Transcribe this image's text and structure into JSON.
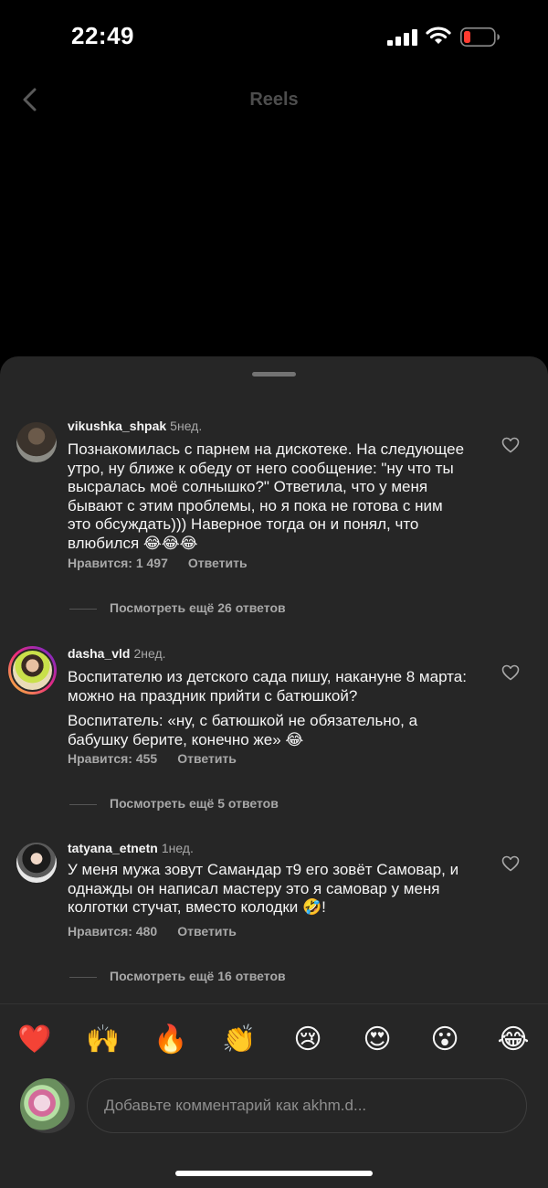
{
  "status_bar": {
    "time": "22:49"
  },
  "header": {
    "title": "Reels"
  },
  "comments": [
    {
      "username": "vikushka_shpak",
      "time": "5нед.",
      "paragraphs": [
        "Познакомилась с парнем на дискотеке. На следующее утро, ну ближе к обеду от него сообщение: \"ну что ты высралась моё солнышко?\" Ответила, что у меня бывают с этим проблемы, но я пока не готова с ним это обсуждать))) Наверное тогда он и понял, что влюбился 😂😂😂"
      ],
      "likes": "Нравится: 1 497",
      "reply_label": "Ответить",
      "view_replies": "Посмотреть ещё 26 ответов"
    },
    {
      "username": "dasha_vld",
      "time": "2нед.",
      "paragraphs": [
        "Воспитателю из детского сада пишу, накануне 8 марта: можно на праздник прийти с батюшкой?",
        "Воспитатель: «ну, с батюшкой не обязательно, а бабушку берите, конечно же» 😂"
      ],
      "likes": "Нравится: 455",
      "reply_label": "Ответить",
      "view_replies": "Посмотреть ещё 5 ответов"
    },
    {
      "username": "tatyana_etnetn",
      "time": "1нед.",
      "paragraphs": [
        "У меня мужа зовут Самандар т9 его зовёт Самовар, и однажды он написал мастеру это я самовар у меня колготки стучат, вместо колодки 🤣!"
      ],
      "likes": "Нравится: 480",
      "reply_label": "Ответить",
      "view_replies": "Посмотреть ещё 16 ответов"
    }
  ],
  "emoji_bar": [
    "❤️",
    "🙌",
    "🔥",
    "👏",
    "😢",
    "😍",
    "😮",
    "😂"
  ],
  "composer": {
    "placeholder": "Добавьте комментарий как akhm.d..."
  },
  "colors": {
    "background": "#000000",
    "sheet": "#262626",
    "text": "#f5f5f5",
    "muted": "#a8a8a8",
    "battery_low": "#ff3b30"
  }
}
